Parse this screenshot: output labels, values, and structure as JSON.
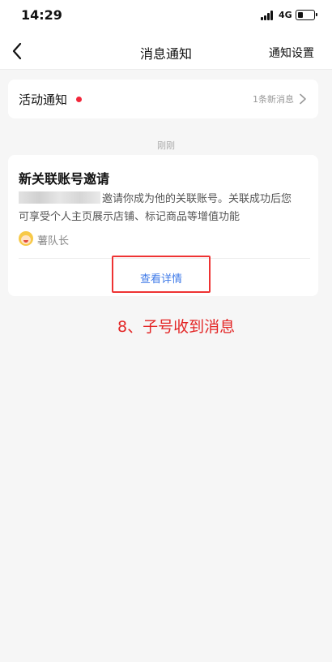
{
  "status_bar": {
    "time": "14:29",
    "network": "4G",
    "battery_level_fraction": 0.35
  },
  "nav": {
    "back_icon": "chevron-left-icon",
    "title": "消息通知",
    "action": "通知设置"
  },
  "activity": {
    "title": "活动通知",
    "unread_dot_color": "#f2263a",
    "new_count": "1条新消息",
    "chevron_icon": "chevron-right-icon"
  },
  "timestamp": "刚刚",
  "message": {
    "title": "新关联账号邀请",
    "body_line1": "邀请你成为他的关联账号。关联成功后您",
    "body_line2": "可享受个人主页展示店铺、标记商品等增值功能",
    "sender": "薯队长",
    "detail_button": "查看详情",
    "link_color": "#3f7ae8",
    "highlight_color": "#e33333"
  },
  "annotation": "8、子号收到消息"
}
